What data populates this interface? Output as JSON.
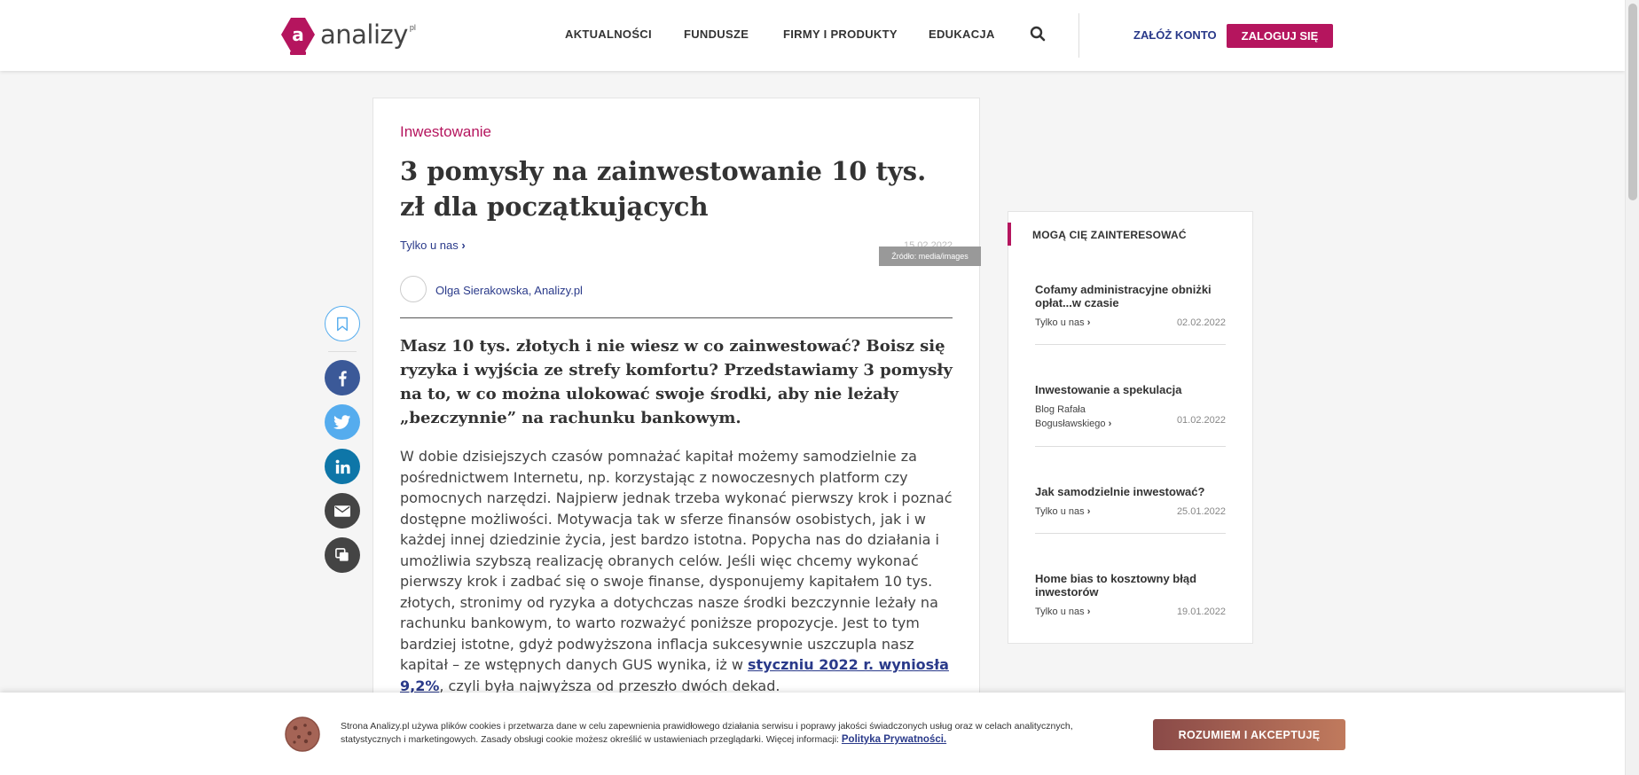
{
  "logo": {
    "text": "analizy",
    "sup": "pl"
  },
  "nav": {
    "items": [
      "AKTUALNOŚCI",
      "FUNDUSZE",
      "FIRMY I PRODUKTY",
      "EDUKACJA"
    ]
  },
  "header": {
    "register_label": "ZAŁÓŻ KONTO",
    "login_label": "ZALOGUJ SIĘ"
  },
  "article": {
    "category": "Inwestowanie",
    "title": "3 pomysły na zainwestowanie 10 tys. zł dla początkujących",
    "exclusive": "Tylko u nas",
    "date": "15.02.2022",
    "image_source": "Źródło: media/images",
    "author": "Olga Sierakowska, Analizy.pl",
    "lead": "Masz 10 tys. złotych i nie wiesz w co zainwestować? Boisz się ryzyka i wyjścia ze strefy komfortu? Przedstawiamy 3 pomysły na to, w co można ulokować swoje środki, aby nie leżały „bezczynnie” na rachunku bankowym.",
    "body_before_link": "W dobie dzisiejszych czasów pomnażać kapitał możemy samodzielnie za pośrednictwem Internetu, np. korzystając z nowoczesnych platform czy pomocnych narzędzi. Najpierw jednak trzeba wykonać pierwszy krok i poznać dostępne możliwości. Motywacja tak w sferze finansów osobistych, jak i w każdej innej dziedzinie życia, jest bardzo istotna. Popycha nas do działania i umożliwia szybszą realizację obranych celów. Jeśli więc chcemy wykonać pierwszy krok i zadbać się o swoje finanse, dysponujemy kapitałem 10 tys. złotych, stronimy od ryzyka a dotychczas nasze środki bezczynnie leżały na rachunku bankowym, to warto rozważyć poniższe propozycje. Jest to tym bardziej istotne, gdyż podwyższona inflacja sukcesywnie uszczupla nasz kapitał – ze wstępnych danych GUS wynika, iż w ",
    "body_link": "styczniu 2022 r. wyniosła 9,2%",
    "body_after_link": ", czyli była najwyższa od przeszło dwóch dekad."
  },
  "sidebar": {
    "title": "MOGĄ CIĘ ZAINTERESOWAĆ",
    "items": [
      {
        "title": "Cofamy administracyjne obniżki opłat...w czasie",
        "meta": "Tylko u nas",
        "date": "02.02.2022"
      },
      {
        "title": "Inwestowanie a spekulacja",
        "meta": "Blog Rafała Bogusławskiego",
        "date": "01.02.2022"
      },
      {
        "title": "Jak samodzielnie inwestować?",
        "meta": "Tylko u nas",
        "date": "25.01.2022"
      },
      {
        "title": "Home bias to kosztowny błąd inwestorów",
        "meta": "Tylko u nas",
        "date": "19.01.2022"
      }
    ]
  },
  "cookie": {
    "text": "Strona Analizy.pl używa plików cookies i przetwarza dane w celu zapewnienia prawidłowego działania serwisu i poprawy jakości świadczonych usług oraz w celach analitycznych, statystycznych i marketingowych. Zasady obsługi cookie możesz określić w ustawieniach przeglądarki. Więcej informacji: ",
    "link": "Polityka Prywatności.",
    "button": "ROZUMIEM I AKCEPTUJĘ"
  },
  "icons": {
    "share": [
      "bookmark-icon",
      "facebook-icon",
      "twitter-icon",
      "linkedin-icon",
      "email-icon",
      "copy-icon"
    ],
    "search": "search-icon"
  },
  "colors": {
    "brand": "#b5155e",
    "link": "#2a3a8a",
    "facebook": "#3b5998",
    "twitter": "#55acee",
    "linkedin": "#0e76a8",
    "dark_share": "#444444"
  }
}
